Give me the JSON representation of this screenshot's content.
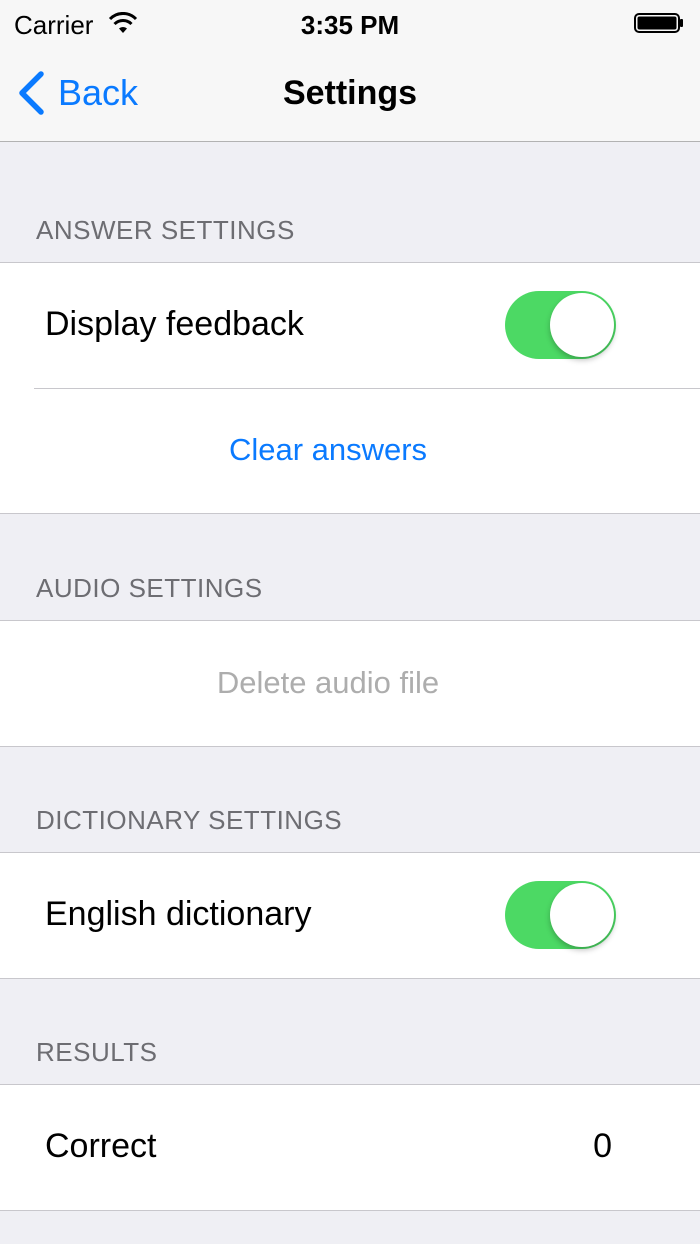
{
  "status_bar": {
    "carrier": "Carrier",
    "time": "3:35 PM"
  },
  "nav": {
    "back_label": "Back",
    "title": "Settings"
  },
  "sections": {
    "answer": {
      "header": "ANSWER SETTINGS",
      "display_feedback_label": "Display feedback",
      "display_feedback_on": true,
      "clear_answers_label": "Clear answers"
    },
    "audio": {
      "header": "AUDIO SETTINGS",
      "delete_audio_label": "Delete audio file"
    },
    "dictionary": {
      "header": "DICTIONARY SETTINGS",
      "english_dictionary_label": "English dictionary",
      "english_dictionary_on": true
    },
    "results": {
      "header": "RESULTS",
      "correct_label": "Correct",
      "correct_value": "0"
    }
  },
  "colors": {
    "accent": "#0a7aff",
    "toggle_on": "#4cd964",
    "disabled_text": "#adadad"
  }
}
